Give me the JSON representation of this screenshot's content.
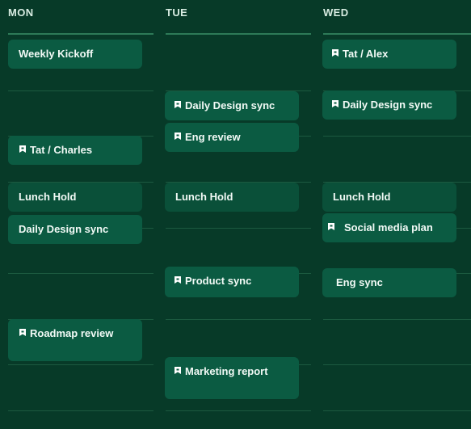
{
  "days": [
    {
      "label": "MON"
    },
    {
      "label": "TUE"
    },
    {
      "label": "WED"
    }
  ],
  "events": {
    "mon": [
      {
        "title": "Weekly Kickoff",
        "pinned": false
      },
      {
        "title": "Tat / Charles",
        "pinned": true
      },
      {
        "title": "Lunch Hold",
        "pinned": false
      },
      {
        "title": "Daily Design sync",
        "pinned": false
      },
      {
        "title": "Roadmap review",
        "pinned": true
      }
    ],
    "tue": [
      {
        "title": "Daily Design sync",
        "pinned": true
      },
      {
        "title": "Eng review",
        "pinned": true
      },
      {
        "title": "Lunch Hold",
        "pinned": false
      },
      {
        "title": "Product sync",
        "pinned": true
      },
      {
        "title": "Marketing report",
        "pinned": true
      }
    ],
    "wed": [
      {
        "title": "Tat / Alex",
        "pinned": true
      },
      {
        "title": "Daily Design sync",
        "pinned": true
      },
      {
        "title": "Lunch Hold",
        "pinned": false
      },
      {
        "title": "Social media plan",
        "pinned": true
      },
      {
        "title": "Eng sync",
        "pinned": false
      }
    ]
  },
  "colors": {
    "background": "#073a28",
    "event": "#0b5b42",
    "gridline": "#1c5a40",
    "header_rule": "#2d7a58"
  },
  "icons": {
    "pinned": "pin-icon"
  }
}
